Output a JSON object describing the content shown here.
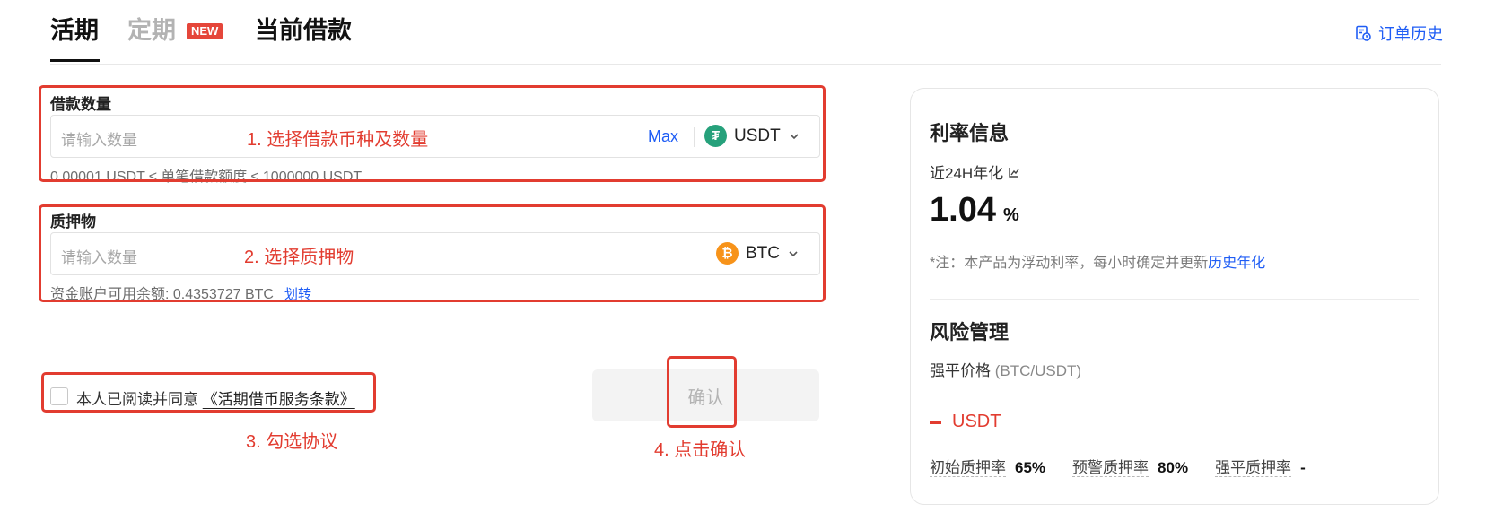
{
  "tabs": {
    "active": "活期",
    "fixed": "定期",
    "fixed_badge": "NEW",
    "loans": "当前借款"
  },
  "header": {
    "order_history": "订单历史"
  },
  "borrow": {
    "label": "借款数量",
    "placeholder": "请输入数量",
    "max": "Max",
    "coin": "USDT",
    "limits": "0.00001 USDT ≤ 单笔借款额度 ≤ 1000000 USDT"
  },
  "collateral": {
    "label": "质押物",
    "placeholder": "请输入数量",
    "coin": "BTC",
    "balance": "资金账户可用余额: 0.4353727 BTC",
    "transfer": "划转"
  },
  "agreement": {
    "text": "本人已阅读并同意",
    "terms": "《活期借币服务条款》"
  },
  "confirm": "确认",
  "annotations": {
    "step1": "1. 选择借款币种及数量",
    "step2": "2. 选择质押物",
    "step3": "3. 勾选协议",
    "step4": "4. 点击确认",
    "color": "#e23c30"
  },
  "rate_info": {
    "title": "利率信息",
    "label": "近24H年化",
    "value": "1.04",
    "unit": "%",
    "note": "*注：本产品为浮动利率，每小时确定并更新",
    "note_link": "历史年化"
  },
  "risk": {
    "title": "风险管理",
    "liq_label": "强平价格",
    "liq_pair": "(BTC/USDT)",
    "liq_unit": "USDT",
    "initial_ltv_label": "初始质押率",
    "initial_ltv": "65%",
    "warning_ltv_label": "预警质押率",
    "warning_ltv": "80%",
    "liq_ltv_label": "强平质押率",
    "liq_ltv": "-"
  },
  "colors": {
    "accent": "#1f5df5",
    "usdt": "#26a17b",
    "btc": "#f7931a"
  }
}
